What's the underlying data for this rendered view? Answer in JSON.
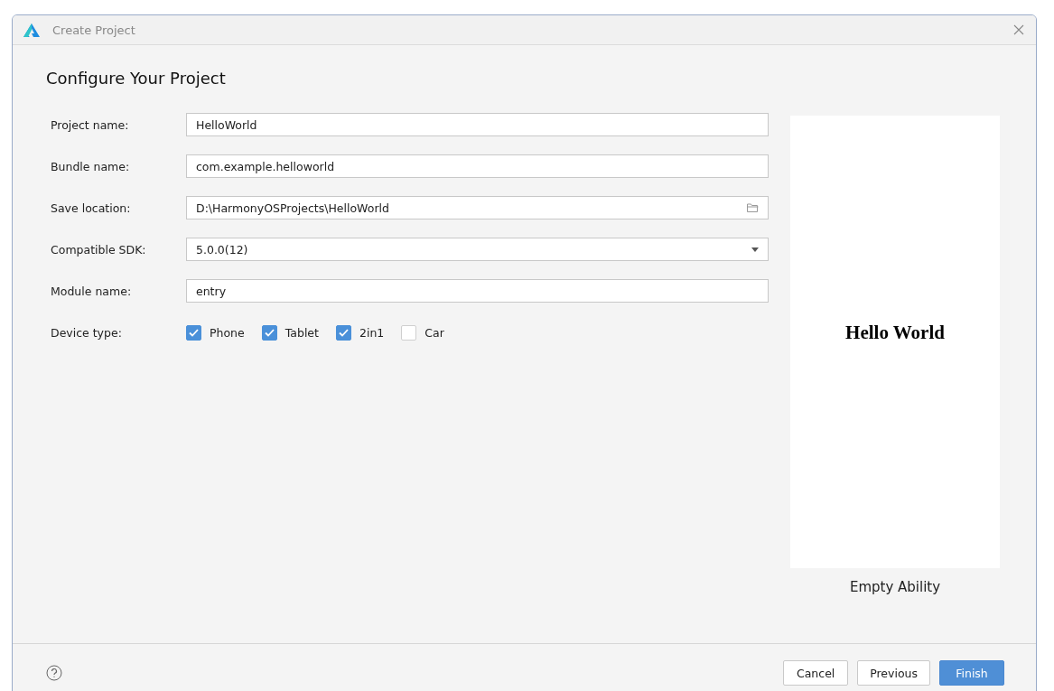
{
  "window": {
    "title": "Create Project"
  },
  "heading": "Configure Your Project",
  "fields": [
    {
      "kind": "text",
      "label": "Project name:",
      "value": "HelloWorld"
    },
    {
      "kind": "text",
      "label": "Bundle name:",
      "value": "com.example.helloworld"
    },
    {
      "kind": "folder",
      "label": "Save location:",
      "value": "D:\\HarmonyOSProjects\\HelloWorld"
    },
    {
      "kind": "dropdown",
      "label": "Compatible SDK:",
      "value": "5.0.0(12)"
    },
    {
      "kind": "text",
      "label": "Module name:",
      "value": "entry"
    },
    {
      "kind": "checkboxes",
      "label": "Device type:",
      "options": [
        {
          "label": "Phone",
          "checked": true
        },
        {
          "label": "Tablet",
          "checked": true
        },
        {
          "label": "2in1",
          "checked": true
        },
        {
          "label": "Car",
          "checked": false
        }
      ]
    }
  ],
  "preview": {
    "text": "Hello World",
    "caption": "Empty Ability"
  },
  "buttons": [
    {
      "label": "Cancel",
      "kind": "normal"
    },
    {
      "label": "Previous",
      "kind": "normal"
    },
    {
      "label": "Finish",
      "kind": "primary"
    }
  ]
}
